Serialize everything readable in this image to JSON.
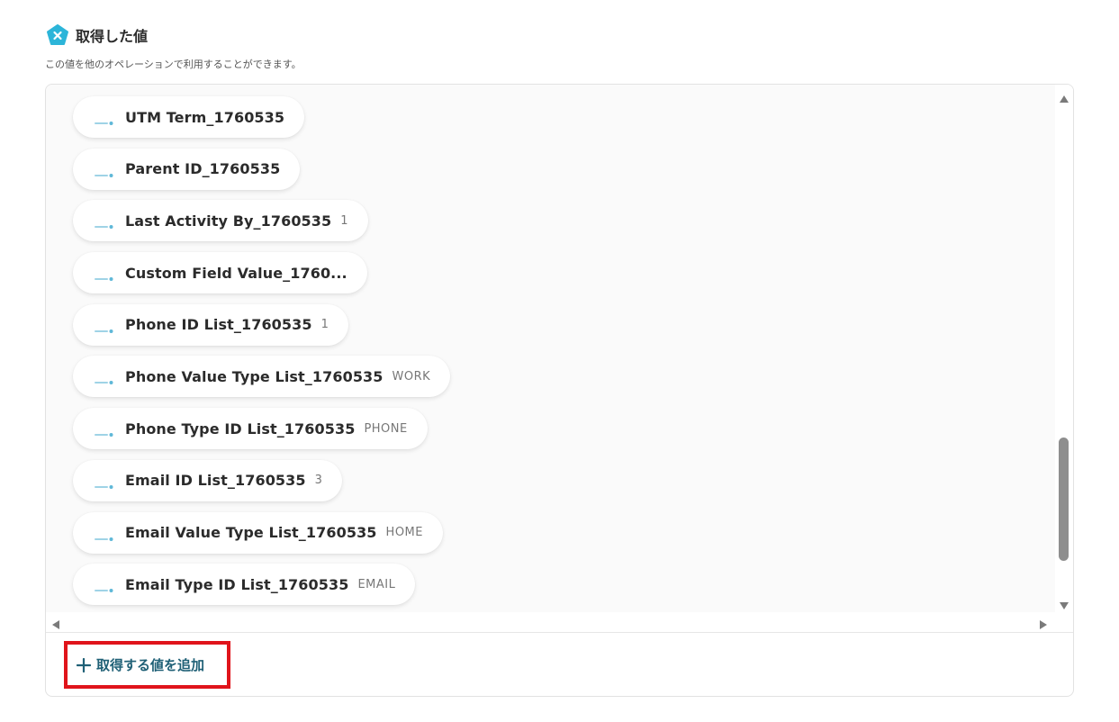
{
  "header": {
    "title": "取得した値",
    "icon": "pentagon-x-icon",
    "icon_color": "#2cb5d9"
  },
  "subtitle": "この値を他のオペレーションで利用することができます。",
  "items": [
    {
      "label": "UTM Term_1760535",
      "value": ""
    },
    {
      "label": "Parent ID_1760535",
      "value": ""
    },
    {
      "label": "Last Activity By_1760535",
      "value": "1"
    },
    {
      "label": "Custom Field Value_1760...",
      "value": ""
    },
    {
      "label": "Phone ID List_1760535",
      "value": "1"
    },
    {
      "label": "Phone Value Type List_1760535",
      "value": "WORK"
    },
    {
      "label": "Phone Type ID List_1760535",
      "value": "PHONE"
    },
    {
      "label": "Email ID List_1760535",
      "value": "3"
    },
    {
      "label": "Email Value Type List_1760535",
      "value": "HOME"
    },
    {
      "label": "Email Type ID List_1760535",
      "value": "EMAIL"
    }
  ],
  "item_icon": "service-logo-icon",
  "footer": {
    "add_label": "取得する値を追加",
    "highlight_color": "#e0141b",
    "accent_color": "#1f6076"
  }
}
